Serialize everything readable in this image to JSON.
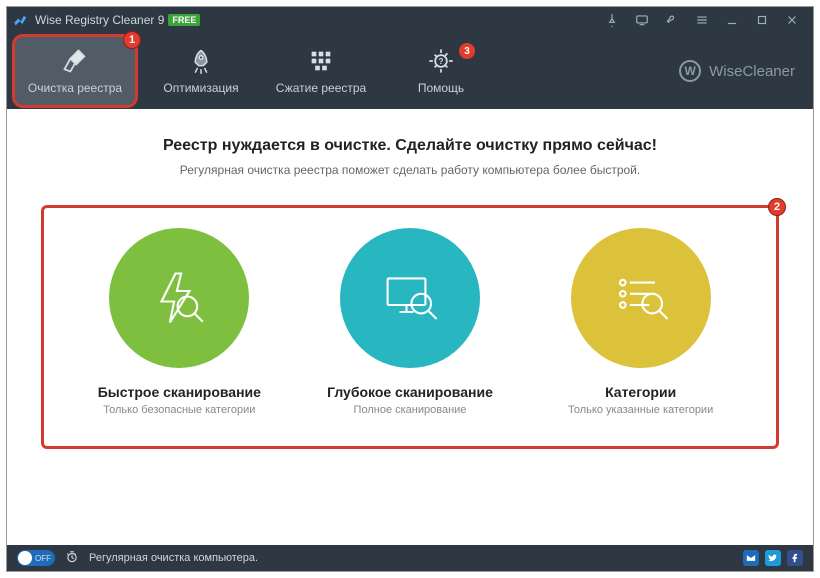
{
  "title": "Wise Registry Cleaner 9",
  "free_badge": "FREE",
  "nav": {
    "items": [
      {
        "label": "Очистка реестра",
        "active": true
      },
      {
        "label": "Оптимизация"
      },
      {
        "label": "Сжатие реестра"
      },
      {
        "label": "Помощь",
        "badge": "3"
      }
    ]
  },
  "brand": "WiseCleaner",
  "main": {
    "headline": "Реестр нуждается в очистке. Сделайте очистку прямо сейчас!",
    "subhead": "Регулярная очистка реестра поможет сделать работу компьютера более быстрой.",
    "actions": [
      {
        "title": "Быстрое сканирование",
        "sub": "Только безопасные категории"
      },
      {
        "title": "Глубокое сканирование",
        "sub": "Полное сканирование"
      },
      {
        "title": "Категории",
        "sub": "Только указанные категории"
      }
    ]
  },
  "callouts": {
    "one": "1",
    "two": "2"
  },
  "status": {
    "toggle": "OFF",
    "text": "Регулярная очистка компьютера."
  }
}
